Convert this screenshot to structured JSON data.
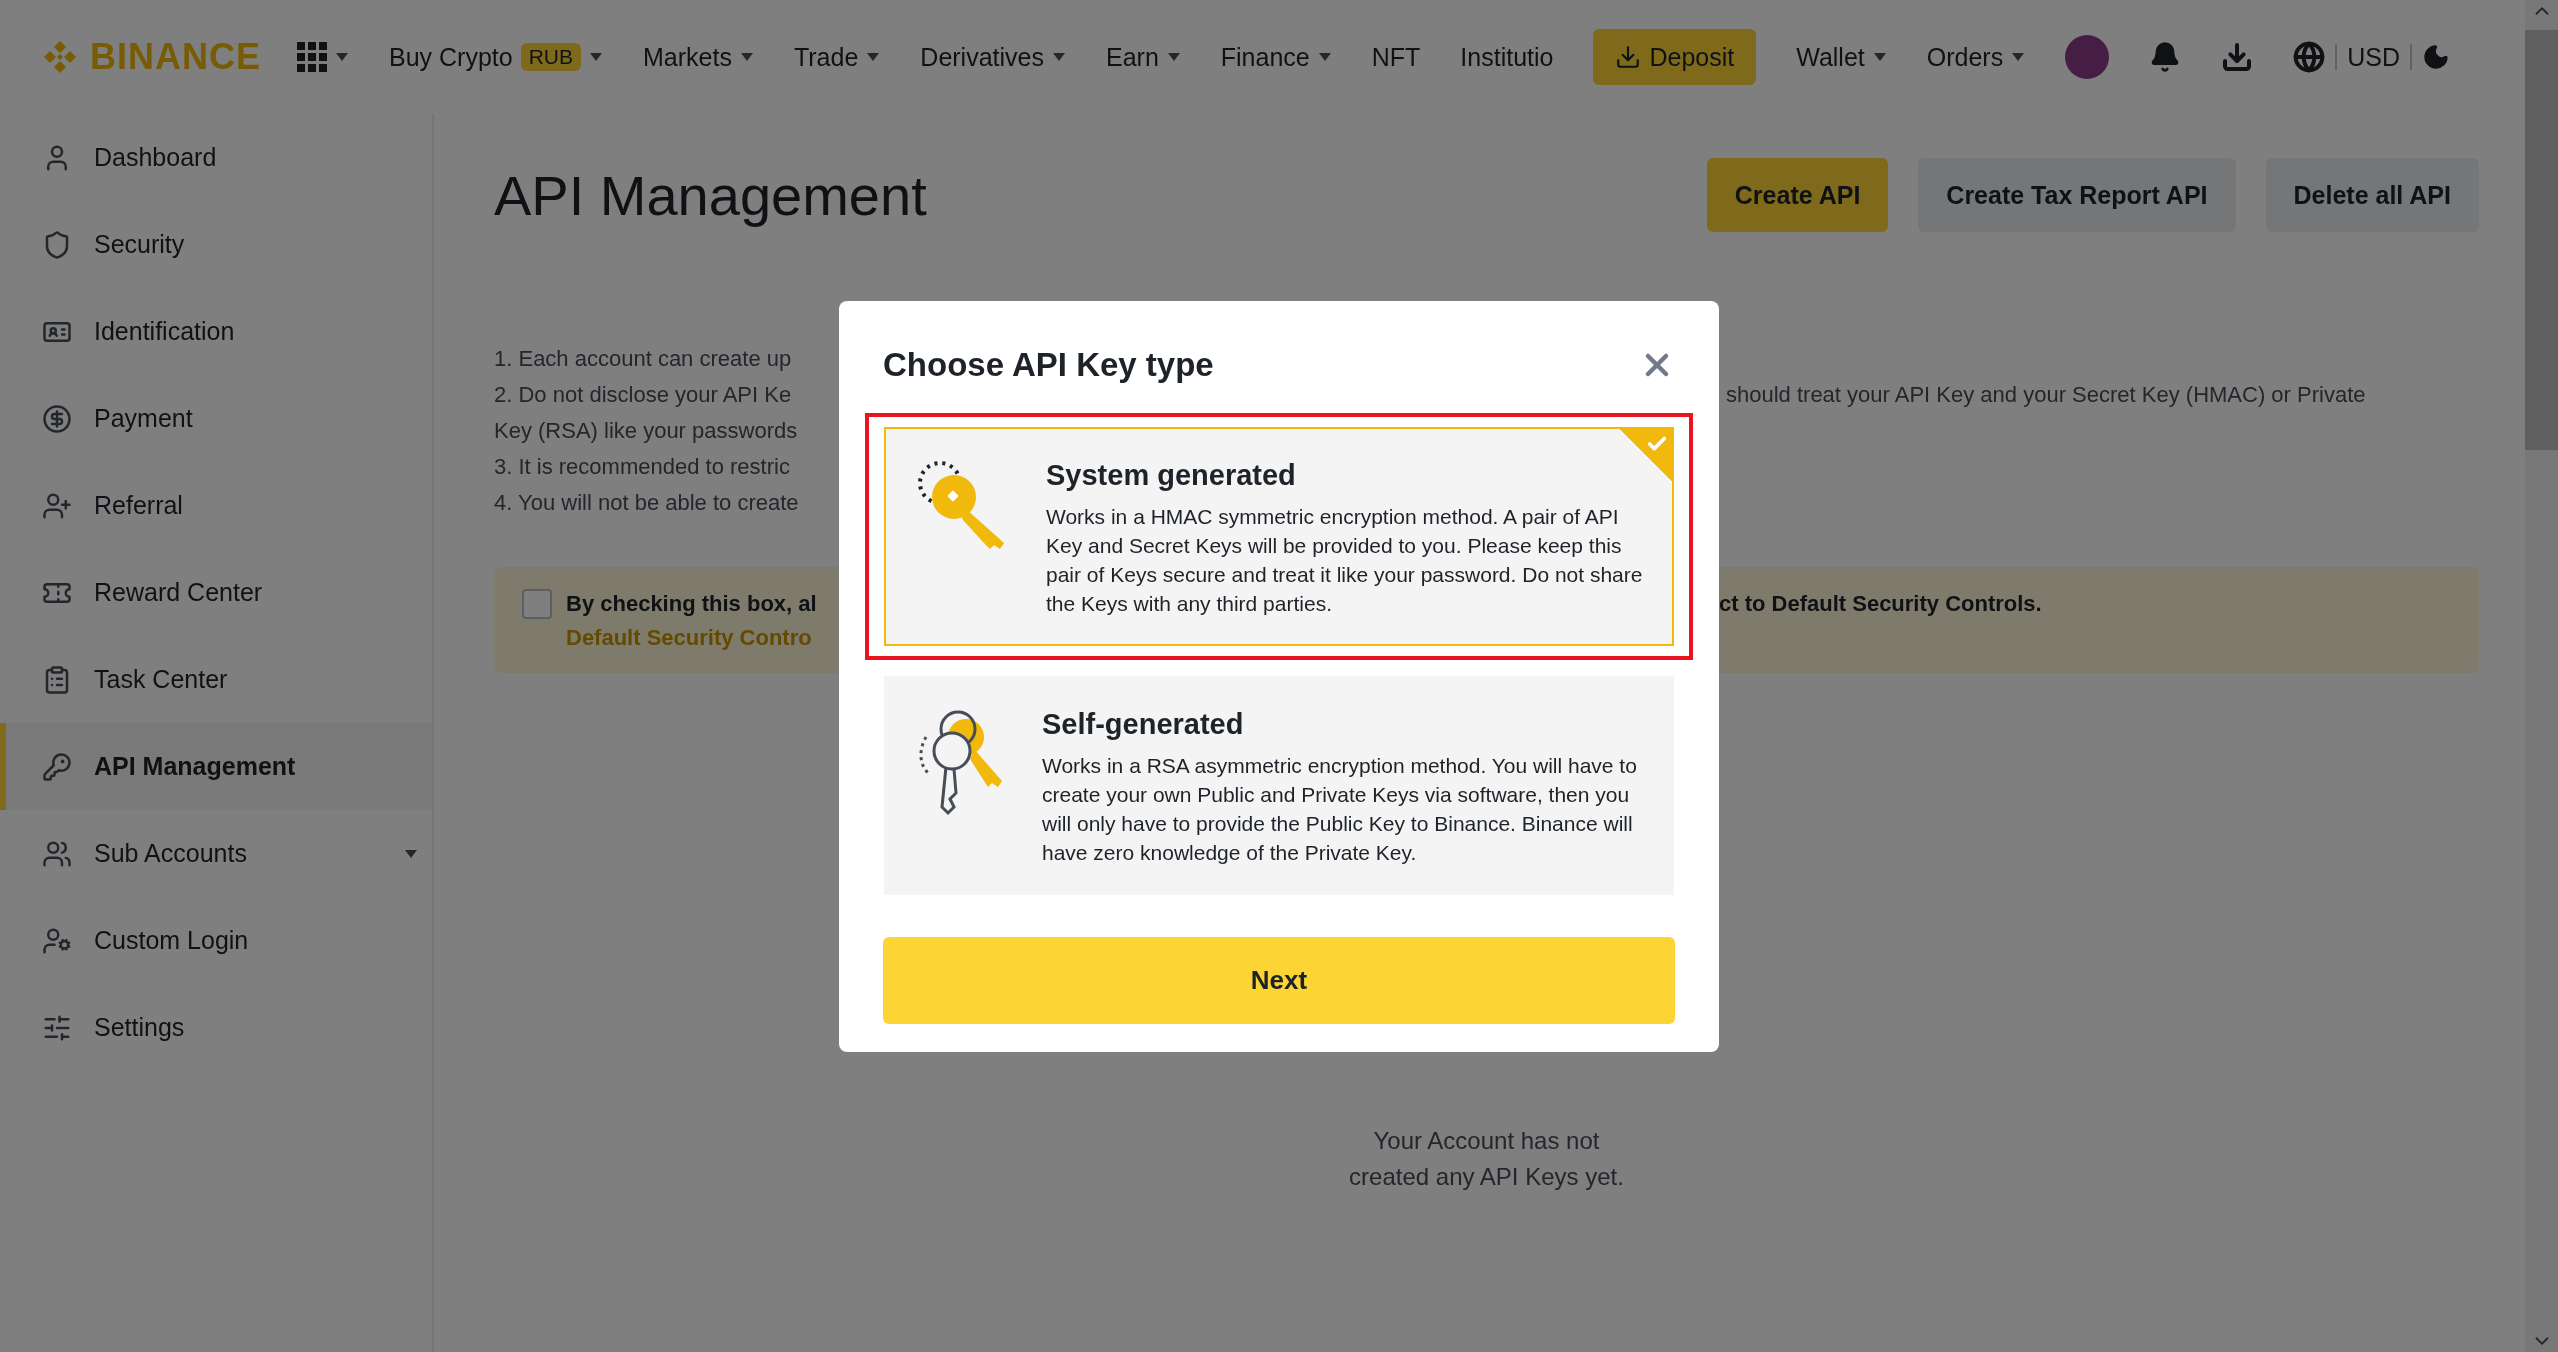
{
  "header": {
    "logo": "BINANCE",
    "nav": [
      {
        "label": "Buy Crypto",
        "badge": "RUB",
        "dropdown": true
      },
      {
        "label": "Markets",
        "dropdown": true
      },
      {
        "label": "Trade",
        "dropdown": true
      },
      {
        "label": "Derivatives",
        "dropdown": true
      },
      {
        "label": "Earn",
        "dropdown": true
      },
      {
        "label": "Finance",
        "dropdown": true
      },
      {
        "label": "NFT",
        "dropdown": false
      },
      {
        "label": "Institutio",
        "dropdown": false
      }
    ],
    "deposit": "Deposit",
    "account_menu": [
      {
        "label": "Wallet",
        "dropdown": true
      },
      {
        "label": "Orders",
        "dropdown": true
      }
    ],
    "currency": "USD"
  },
  "sidebar": {
    "items": [
      {
        "label": "Dashboard",
        "selected": false,
        "expandable": false
      },
      {
        "label": "Security",
        "selected": false,
        "expandable": false
      },
      {
        "label": "Identification",
        "selected": false,
        "expandable": false
      },
      {
        "label": "Payment",
        "selected": false,
        "expandable": false
      },
      {
        "label": "Referral",
        "selected": false,
        "expandable": false
      },
      {
        "label": "Reward Center",
        "selected": false,
        "expandable": false
      },
      {
        "label": "Task Center",
        "selected": false,
        "expandable": false
      },
      {
        "label": "API Management",
        "selected": true,
        "expandable": false
      },
      {
        "label": "Sub Accounts",
        "selected": false,
        "expandable": true
      },
      {
        "label": "Custom Login",
        "selected": false,
        "expandable": false
      },
      {
        "label": "Settings",
        "selected": false,
        "expandable": false
      }
    ]
  },
  "main": {
    "title": "API Management",
    "buttons": [
      {
        "label": "Create API",
        "kind": "primary"
      },
      {
        "label": "Create Tax Report API",
        "kind": "secondary"
      },
      {
        "label": "Delete all API",
        "kind": "secondary"
      }
    ],
    "notes": [
      {
        "left": "1. Each account can create up"
      },
      {
        "left": "2. Do not disclose your API Ke",
        "right": "should treat your API Key and your Secret Key (HMAC) or Private"
      },
      {
        "left": "Key (RSA) like your passwords"
      },
      {
        "left": "3. It is recommended to restric"
      },
      {
        "left": "4. You will not be able to create"
      }
    ],
    "consent": {
      "checked": false,
      "text_left": "By checking this box, al",
      "text_right": "ct to Default Security Controls.",
      "link": "Default Security Contro"
    },
    "empty_state": "Your Account has not created any API Keys yet."
  },
  "modal": {
    "title": "Choose API Key type",
    "options": [
      {
        "kind": "system",
        "title": "System generated",
        "description": "Works in a HMAC symmetric encryption method. A pair of API Key and Secret Keys will be provided to you. Please keep this pair of Keys secure and treat it like your password. Do not share the Keys with any third parties.",
        "selected": true,
        "annotated": true
      },
      {
        "kind": "self",
        "title": "Self-generated",
        "description": "Works in a RSA asymmetric encryption method. You will have to create your own Public and Private Keys via software, then you will only have to provide the Public Key to Binance. Binance will have zero knowledge of the Private Key.",
        "selected": false,
        "annotated": false
      }
    ],
    "next": "Next"
  }
}
